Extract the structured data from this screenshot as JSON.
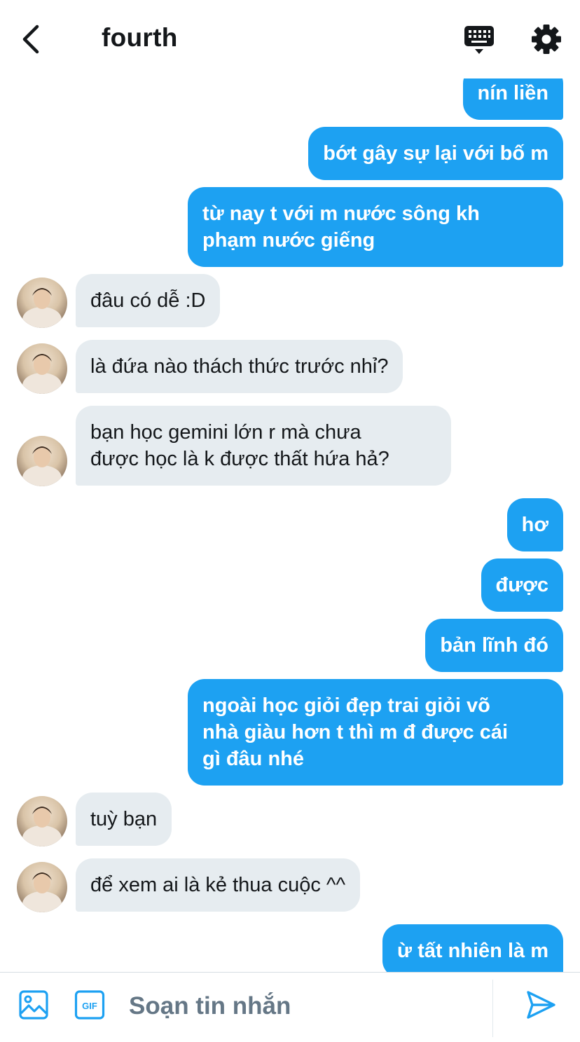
{
  "header": {
    "title": "fourth",
    "icons": {
      "back": "chevron-left-icon",
      "keyboard": "keyboard-icon",
      "settings": "gear-icon"
    }
  },
  "messages": [
    {
      "direction": "out",
      "text": "nín liền"
    },
    {
      "direction": "out",
      "text": "bớt gây sự lại với bố m"
    },
    {
      "direction": "out",
      "text": "từ nay t với m nước sông kh\nphạm nước giếng"
    },
    {
      "direction": "in",
      "text": "đâu có dễ :D"
    },
    {
      "direction": "in",
      "text": "là đứa nào thách thức trước nhỉ?"
    },
    {
      "direction": "in",
      "text": "bạn học gemini lớn r mà chưa\nđược học là k được thất hứa hả?"
    },
    {
      "direction": "out",
      "text": "hơ"
    },
    {
      "direction": "out",
      "text": "được"
    },
    {
      "direction": "out",
      "text": "bản lĩnh đó"
    },
    {
      "direction": "out",
      "text": "ngoài học giỏi đẹp trai giỏi võ\nnhà giàu hơn t thì m đ được cái\ngì đâu nhé"
    },
    {
      "direction": "in",
      "text": "tuỳ bạn"
    },
    {
      "direction": "in",
      "text": "để xem ai là kẻ thua cuộc ^^"
    },
    {
      "direction": "out",
      "text": "ừ tất nhiên là m"
    }
  ],
  "composer": {
    "placeholder": "Soạn tin nhắn",
    "value": "",
    "gif_label": "GIF",
    "icons": {
      "image": "image-icon",
      "gif": "gif-icon",
      "send": "send-icon"
    }
  },
  "colors": {
    "outgoing_bubble": "#1da1f2",
    "incoming_bubble": "#e6ecf0",
    "accent": "#1da1f2",
    "text_dark": "#14171a",
    "placeholder": "#657786"
  }
}
